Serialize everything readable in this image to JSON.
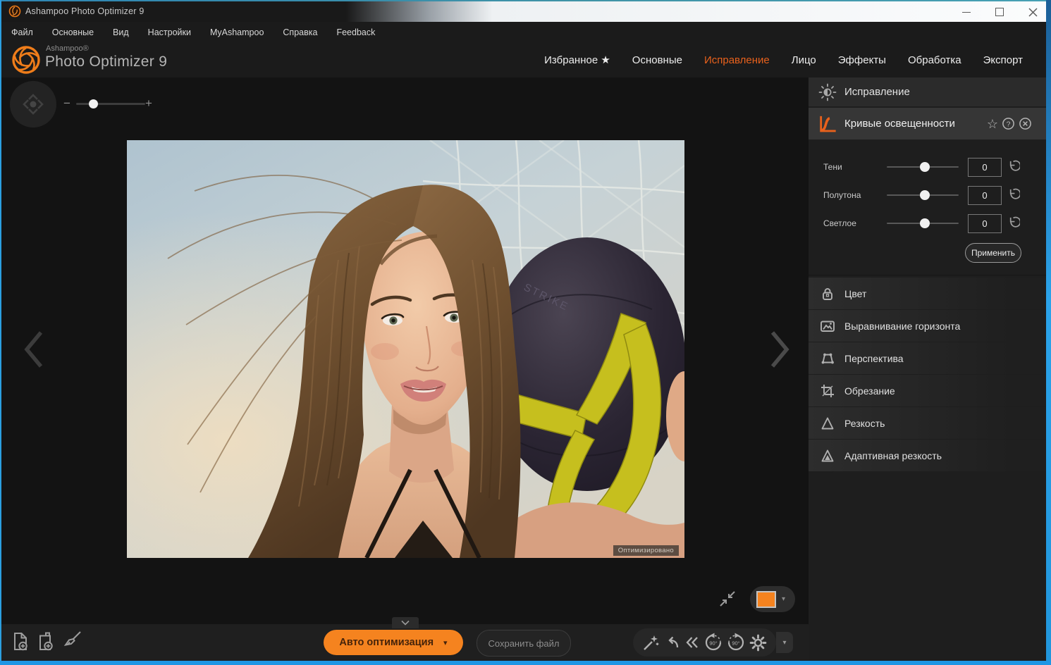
{
  "window": {
    "title": "Ashampoo Photo Optimizer 9"
  },
  "menu": {
    "items": [
      "Файл",
      "Основные",
      "Вид",
      "Настройки",
      "MyAshampoo",
      "Справка",
      "Feedback"
    ]
  },
  "brand": {
    "company": "Ashampoo®",
    "product": "Photo Optimizer 9"
  },
  "nav": {
    "items": [
      "Избранное ★",
      "Основные",
      "Исправление",
      "Лицо",
      "Эффекты",
      "Обработка",
      "Экспорт"
    ],
    "active_item": "Исправление"
  },
  "panel": {
    "section_title": "Исправление",
    "tool_title": "Кривые освещенности",
    "sliders": [
      {
        "label": "Тени",
        "value": "0"
      },
      {
        "label": "Полутона",
        "value": "0"
      },
      {
        "label": "Светлое",
        "value": "0"
      }
    ],
    "apply_label": "Применить",
    "tools": [
      "Цвет",
      "Выравнивание горизонта",
      "Перспектива",
      "Обрезание",
      "Резкость",
      "Адаптивная резкость"
    ]
  },
  "canvas": {
    "optimized_badge": "Оптимизировано",
    "zoom_minus": "−",
    "zoom_plus": "+"
  },
  "photo": {
    "ball_text": "STRIKE"
  },
  "toolbar": {
    "auto_optimize_label": "Авто оптимизация",
    "save_label": "Сохранить файл",
    "rotate_left_label": "90°",
    "rotate_right_label": "90°"
  },
  "colors": {
    "accent": "#f5831f",
    "nav_active": "#e8611c",
    "window_border": "#2b9fe0"
  }
}
